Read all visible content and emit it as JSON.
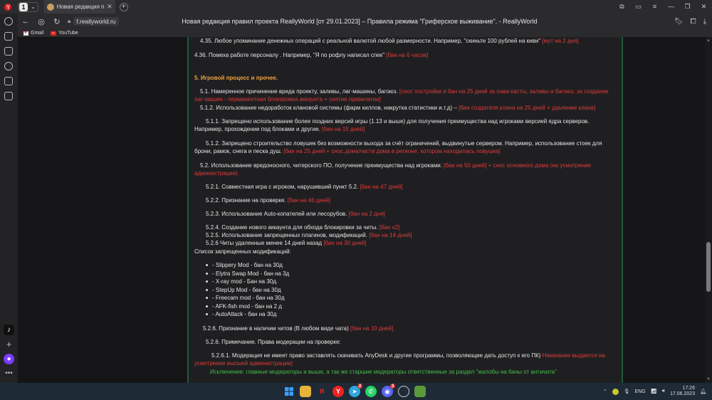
{
  "browser": {
    "tab_counter": "1",
    "tab_title": "Новая редакция прави",
    "url": "f.reallyworld.ru",
    "page_title": "Новая редакция правил проекта ReallyWorld [от 29.01.2023] – Правила режима \"Гриферское выживание\". - ReallyWorld",
    "bookmarks": [
      "Gmail",
      "YouTube"
    ]
  },
  "content": {
    "r435": "4.35. Любое упоминание денежных операций с реальной валютой любой размерности. Например, \"скиньте 100 рублей на киви\"",
    "r435_p": "[мут на 2 дня]",
    "r436": "4.36. Помеха работе персоналу . Например, \"Я по рофлу написал спек\"",
    "r436_p": "[бан на 6 часов]",
    "s5": "5. Игровой процесс и прочее.",
    "r51": "5.1. Намеренное причинение вреда проекту, заливы, лаг-машины, багоюз.",
    "r51_p1": "[снос постройки и бан на 25 дней за лава-касты, заливы и багоюз, за создание",
    "r51_p2a": "лаг-машин -",
    "r51_p2b": "перманентная блокировка аккаунта + снятие привилегии]",
    "r512a": "5.1.2. Использование недоработок клановой системы (фарм киллов, накрутка статистики и.т.д) –",
    "r512a_p": "[бан создателя клана на 25 дней + удаление клана]",
    "r511_1": "5.1.1. Запрещено использование более поздних версий игры (1.13 и выше) для получения преимущества над игроками версией ядра серверов.",
    "r511_2": "Например, прохождение под блоками и другие.",
    "r511_p": "[бан на 15 дней]",
    "r512b_1": "5.1.2. Запрещено строительство ловушек без возможности выхода за счёт ограничений, выдвинутые сервером. Например, использование стоек для",
    "r512b_2": "брони, рамок, снега и песка душ.",
    "r512b_p": "[бан на 25 дней + снос дома/части дома в регионе, котором находилась ловушка]",
    "r52": "5.2. Использование вредоносного, читерского ПО, получение преимущества над игроками.",
    "r52_p1": "[бан на 50 дней] + снос основного дома (на усмотрение",
    "r52_p2": "администрации).",
    "r521": "5.2.1. Совместная игра с игроком, нарушивший пункт 5.2.",
    "r521_p": "[бан на 47  дней]",
    "r522": "5.2.2. Признание на проверке.",
    "r522_p": "[бан на 46 дней]",
    "r523": "5.2.3. Использование Auto-копателей или лесорубов.",
    "r523_p": "[бан на 2 дня]",
    "r524": "5.2.4. Создание нового аккаунта для обхода блокировки за читы.",
    "r524_p": "[бан х2]",
    "r525": "5.2.5. Использование запрещенных плагинов, модификаций.",
    "r525_p": "[бан на 14  дней]",
    "r526a": "5.2.6 Читы удаленные менее 14 дней назад",
    "r526a_p": "[бан на 30  дней]",
    "list_head": "Список запрещенных модификаций:",
    "mods": [
      "- Slippery Mod - бан на 30д",
      "- Elytra Swap Mod - бан на 3д",
      "- X-ray mod - Бан на 30д.",
      "- StepUp Mod - бан на 30д",
      "- Freecam mod - бан на 30д",
      "- AFK-fish mod - бан на 2 д",
      "- AutoAttack - бан на 30д"
    ],
    "r526b": "5.2.6. Признание в наличии читов (В любом виде чата)",
    "r526b_p": "[бан на 10  дней]",
    "r526c": "5.2.6. Примечание. Права модерации на проверке:",
    "r5261_1": "5.2.6.1. Модерация не имеет право заставлять скачивать AnyDesk и другие программы, позволяющие дать доступ к его ПК)",
    "r5261_p1": "Наказание выдается на",
    "r5261_p2": "усмотрение высшей администрации)",
    "exception": "Исключение: главные модераторы и выше, а так же старшие модераторы ответственные за раздел \"жалобы на баны от античита\""
  },
  "taskbar": {
    "lang": "ENG",
    "time": "17:26",
    "date": "17.06.2023",
    "telegram_badge": "2",
    "discord_badge": "3"
  }
}
